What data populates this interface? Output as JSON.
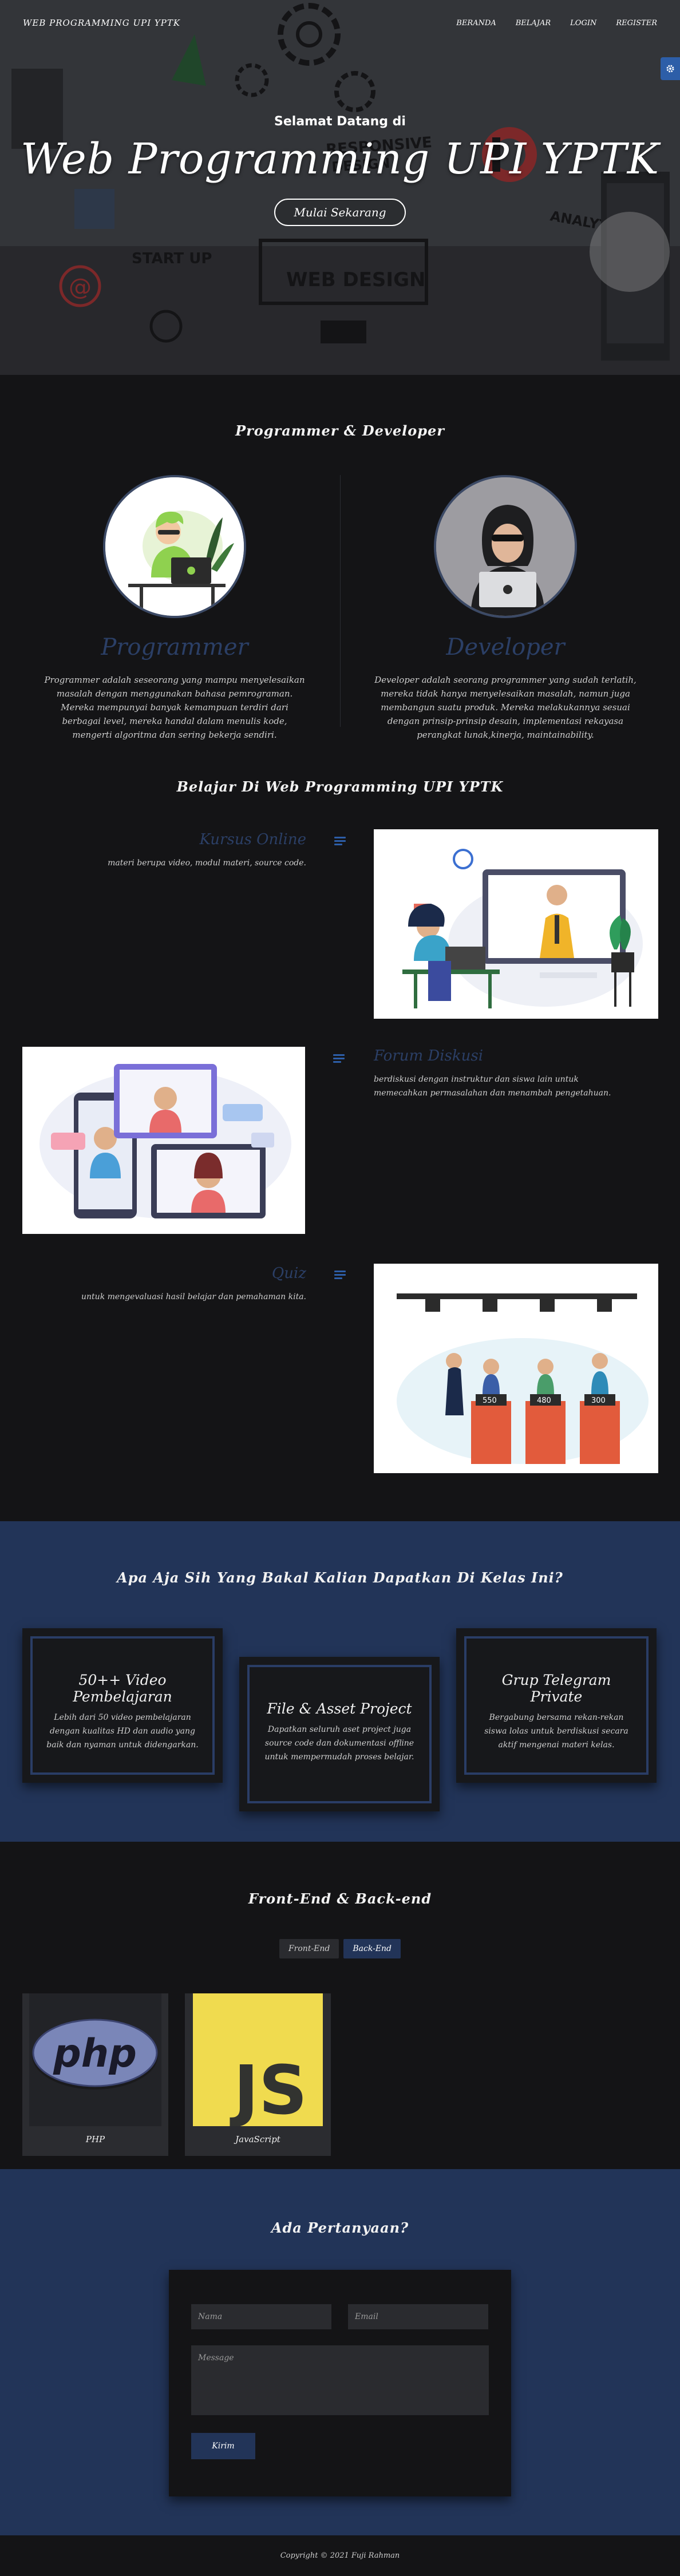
{
  "nav": {
    "brand": "WEB PROGRAMMING UPI YPTK",
    "links": [
      "BERANDA",
      "BELAJAR",
      "LOGIN",
      "REGISTER"
    ]
  },
  "hero": {
    "welcome": "Selamat Datang di",
    "title": "Web Programming UPI YPTK",
    "button": "Mulai Sekarang"
  },
  "intro": {
    "title": "Programmer & Developer",
    "programmer": {
      "name": "Programmer",
      "desc": "Programmer adalah seseorang yang mampu menyelesaikan masalah dengan menggunakan bahasa pemrograman. Mereka mempunyai banyak kemampuan terdiri dari berbagai level, mereka handal dalam menulis kode, mengerti algoritma dan sering bekerja sendiri."
    },
    "developer": {
      "name": "Developer",
      "desc": "Developer adalah seorang programmer yang sudah terlatih, mereka tidak hanya menyelesaikan masalah, namun juga membangun suatu produk. Mereka melakukannya sesuai dengan prinsip-prinsip desain, implementasi rekayasa perangkat lunak,kinerja, maintainability."
    }
  },
  "learn": {
    "title": "Belajar Di Web Programming UPI YPTK",
    "features": [
      {
        "title": "Kursus Online",
        "desc": "materi berupa video, modul materi, source code."
      },
      {
        "title": "Forum Diskusi",
        "desc": "berdiskusi dengan instruktur dan siswa lain untuk memecahkan permasalahan dan menambah pengetahuan."
      },
      {
        "title": "Quiz",
        "desc": "untuk mengevaluasi hasil belajar dan pemahaman kita."
      }
    ]
  },
  "benefits": {
    "title": "Apa Aja Sih Yang Bakal Kalian Dapatkan Di Kelas Ini?",
    "cards": [
      {
        "title": "50++ Video Pembelajaran",
        "desc": "Lebih dari 50 video pembelajaran dengan kualitas HD dan audio yang baik dan nyaman untuk didengarkan."
      },
      {
        "title": "File & Asset Project",
        "desc": "Dapatkan seluruh aset project juga source code dan dokumentasi offline untuk mempermudah proses belajar."
      },
      {
        "title": "Grup Telegram Private",
        "desc": "Bergabung bersama rekan-rekan siswa lolas untuk berdiskusi secara aktif mengenai materi kelas."
      }
    ]
  },
  "stack": {
    "title": "Front-End & Back-end",
    "tabs": [
      "Front-End",
      "Back-End"
    ],
    "active_tab": "Back-End",
    "items": [
      {
        "name": "PHP",
        "logo_text": "php"
      },
      {
        "name": "JavaScript",
        "logo_text": "JS"
      }
    ]
  },
  "contact": {
    "title": "Ada Pertanyaan?",
    "name_placeholder": "Nama",
    "email_placeholder": "Email",
    "message_placeholder": "Message",
    "submit": "Kirim"
  },
  "footer": {
    "text": "Copyright © 2021 Fuji Rahman"
  },
  "colors": {
    "accent": "#2d5ea8",
    "navy": "#223458",
    "background": "#141416"
  }
}
